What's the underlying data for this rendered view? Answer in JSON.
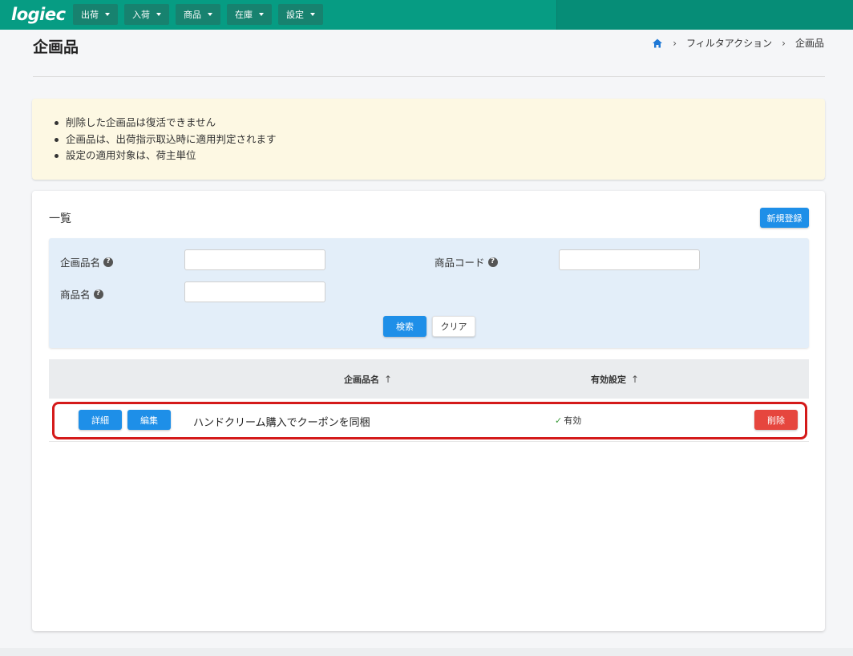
{
  "app": {
    "logo": "logiec"
  },
  "nav": {
    "items": [
      {
        "label": "出荷"
      },
      {
        "label": "入荷"
      },
      {
        "label": "商品"
      },
      {
        "label": "在庫"
      },
      {
        "label": "設定"
      }
    ]
  },
  "page": {
    "title": "企画品"
  },
  "breadcrumb": {
    "items": [
      "フィルタアクション",
      "企画品"
    ],
    "separator": "›",
    "home_icon": "home-icon"
  },
  "notice": {
    "items": [
      "削除した企画品は復活できません",
      "企画品は、出荷指示取込時に適用判定されます",
      "設定の適用対象は、荷主単位"
    ]
  },
  "list": {
    "title": "一覧",
    "new_button": "新規登録",
    "search": {
      "fields": [
        {
          "label": "企画品名",
          "value": "",
          "help_icon": "help-icon"
        },
        {
          "label": "商品コード",
          "value": "",
          "help_icon": "help-icon"
        },
        {
          "label": "商品名",
          "value": "",
          "help_icon": "help-icon"
        }
      ],
      "search_button": "検索",
      "clear_button": "クリア"
    },
    "table": {
      "columns": [
        {
          "label": "企画品名",
          "sort": "↑"
        },
        {
          "label": "有効設定",
          "sort": "↑"
        }
      ],
      "rows": [
        {
          "detail_button": "詳細",
          "edit_button": "編集",
          "name": "ハンドクリーム購入でクーポンを同梱",
          "status": "有効",
          "status_icon": "check-icon",
          "delete_button": "削除"
        }
      ]
    }
  },
  "colors": {
    "header": "#069c83",
    "primary": "#1e8fe8",
    "danger": "#e6463e",
    "notice_bg": "#fdf8e3",
    "search_bg": "#e3eef9",
    "highlight": "#d41a1a"
  }
}
